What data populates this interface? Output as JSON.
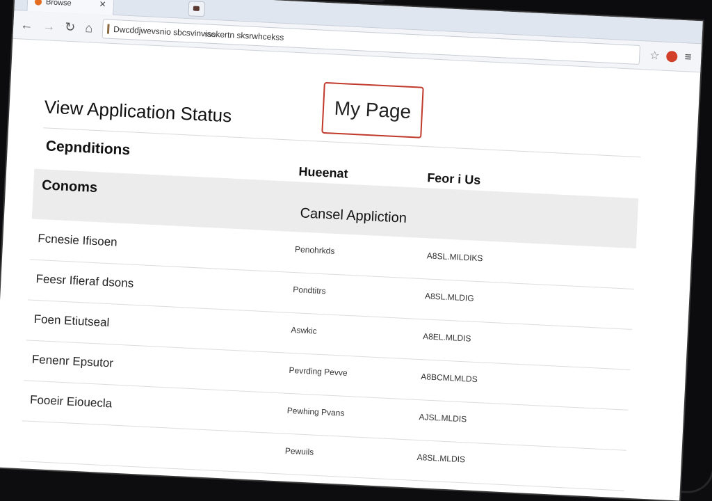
{
  "browser": {
    "tab_title": "Browse",
    "url": "Dwcddjwevsnio sbcsvinvisokertn sksrwhcekss",
    "url_sub": "sss"
  },
  "page": {
    "brand": "My Page",
    "title": "View Application Status",
    "section_label": "Cepnditions",
    "columns": {
      "status": "Hueenat",
      "reference": "Feor i Us"
    },
    "band_label": "Conoms",
    "cancel_action": "Cansel Appliction",
    "rows": [
      {
        "name": "Fcnesie Ifisoen",
        "status": "Penohrkds",
        "ref": "A8SL.MILDIKS"
      },
      {
        "name": "Feesr Ifieraf dsons",
        "status": "Pondtitrs",
        "ref": "A8SL.MLDIG"
      },
      {
        "name": "Foen Etiutseal",
        "status": "Aswkic",
        "ref": "A8EL.MLDIS"
      },
      {
        "name": "Fenenr Epsutor",
        "status": "Pevrding Pevve",
        "ref": "A8BCMLMLDS"
      },
      {
        "name": "Fooeir Eiouecla",
        "status": "Pewhing Pvans",
        "ref": "AJSL.MLDIS"
      },
      {
        "name": "",
        "status": "Pewuils",
        "ref": "A8SL.MLDIS"
      }
    ]
  }
}
